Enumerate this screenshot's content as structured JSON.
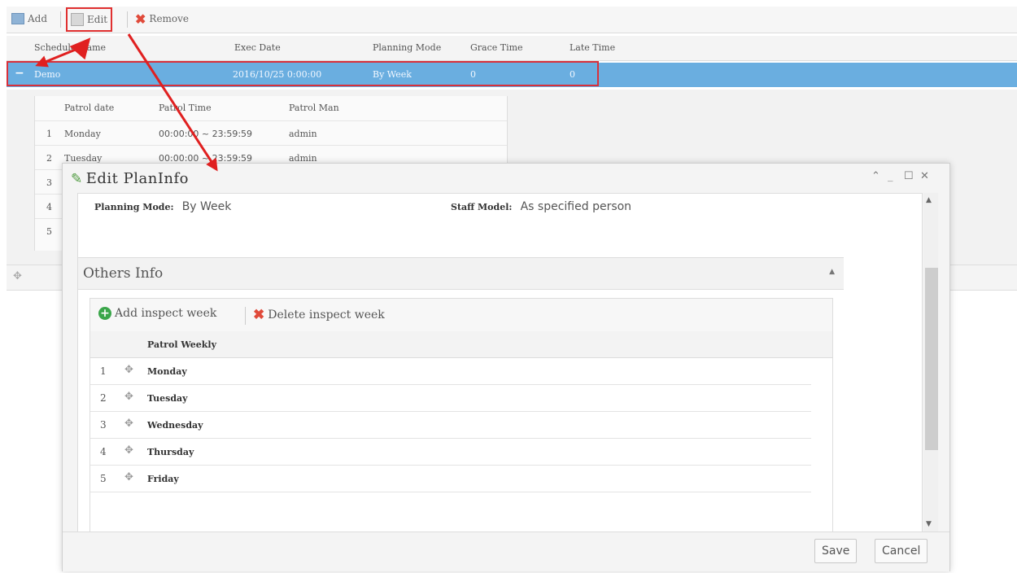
{
  "toolbar": {
    "add_label": "Add",
    "edit_label": "Edit",
    "remove_label": "Remove"
  },
  "schedule_grid": {
    "columns": [
      "Schedule Name",
      "Exec Date",
      "Planning Mode",
      "Grace Time",
      "Late Time"
    ],
    "selected_row": {
      "collapse_glyph": "−",
      "name": "Demo",
      "exec_date": "2016/10/25 0:00:00",
      "planning_mode": "By Week",
      "grace_time": "0",
      "late_time": "0"
    }
  },
  "patrol_detail": {
    "columns": [
      "Patrol date",
      "Patrol Time",
      "Patrol Man"
    ],
    "rows": [
      {
        "num": "1",
        "date": "Monday",
        "time": "00:00:00 ~ 23:59:59",
        "man": "admin"
      },
      {
        "num": "2",
        "date": "Tuesday",
        "time": "00:00:00 ~ 23:59:59",
        "man": "admin"
      },
      {
        "num": "3",
        "date": "",
        "time": "",
        "man": ""
      },
      {
        "num": "4",
        "date": "",
        "time": "",
        "man": ""
      },
      {
        "num": "5",
        "date": "",
        "time": "",
        "man": ""
      }
    ]
  },
  "modal": {
    "title": "Edit PlanInfo",
    "planning_mode_label": "Planning Mode:",
    "planning_mode_value": "By Week",
    "staff_model_label": "Staff Model:",
    "staff_model_value": "As specified person",
    "others_info_title": "Others Info",
    "add_week_label": "Add inspect week",
    "delete_week_label": "Delete inspect week",
    "weekly_header": "Patrol Weekly",
    "weekly_rows": [
      {
        "num": "1",
        "day": "Monday"
      },
      {
        "num": "2",
        "day": "Tuesday"
      },
      {
        "num": "3",
        "day": "Wednesday"
      },
      {
        "num": "4",
        "day": "Thursday"
      },
      {
        "num": "5",
        "day": "Friday"
      }
    ],
    "save_label": "Save",
    "cancel_label": "Cancel"
  },
  "colors": {
    "selected_row": "#6aaee0",
    "highlight_red": "#e03030",
    "add_green": "#3aa64a",
    "remove_red": "#e04a3a"
  },
  "icons": [
    "add-icon",
    "edit-icon",
    "remove-icon",
    "pencil-icon",
    "plus-circle-icon",
    "x-mark-icon",
    "expand-icon"
  ]
}
